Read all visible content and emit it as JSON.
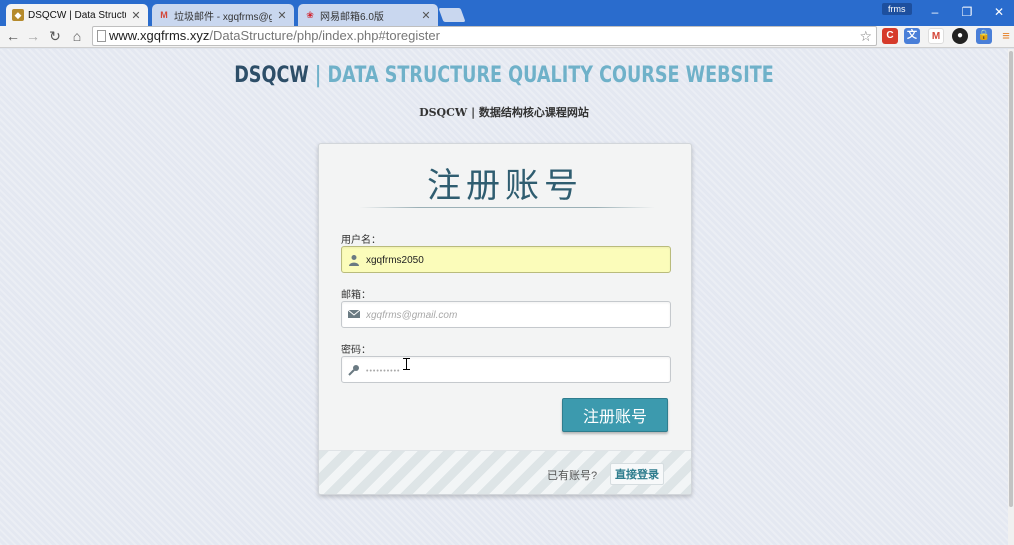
{
  "browser": {
    "tabs": [
      {
        "title": "DSQCW | Data Structure Q",
        "favicon": "site-logo-icon",
        "active": true
      },
      {
        "title": "垃圾邮件 - xgqfrms@gma",
        "favicon": "gmail-icon",
        "active": false
      },
      {
        "title": "网易邮箱6.0版",
        "favicon": "netease-mail-icon",
        "active": false
      }
    ],
    "profile_name": "frms",
    "url_host": "www.xgqfrms.xyz",
    "url_path": "/DataStructure/php/index.php#toregister",
    "window_controls": {
      "minimize": "–",
      "restore": "❐",
      "close": "✕"
    }
  },
  "site": {
    "title_abbr": "DSQCW",
    "title_rest": " | DATA STRUCTURE QUALITY COURSE WEBSITE",
    "subtitle": "DSQCW | 数据结构核心课程网站"
  },
  "form": {
    "heading": "注册账号",
    "username": {
      "label": "用户名：",
      "value": "xgqfrms2050",
      "icon": "user-icon"
    },
    "email": {
      "label": "邮箱：",
      "placeholder": "xgqfrms@gmail.com",
      "icon": "envelope-icon"
    },
    "password": {
      "label": "密码：",
      "placeholder": "••••••••••",
      "icon": "key-icon"
    },
    "submit_label": "注册账号",
    "footer_text": "已有账号?",
    "login_link": "直接登录"
  },
  "colors": {
    "chrome_blue": "#2a6ccd",
    "title_dark": "#2d4e68",
    "title_light": "#6fb1c9",
    "button": "#3c9aae",
    "autofill": "#fbfcba"
  }
}
